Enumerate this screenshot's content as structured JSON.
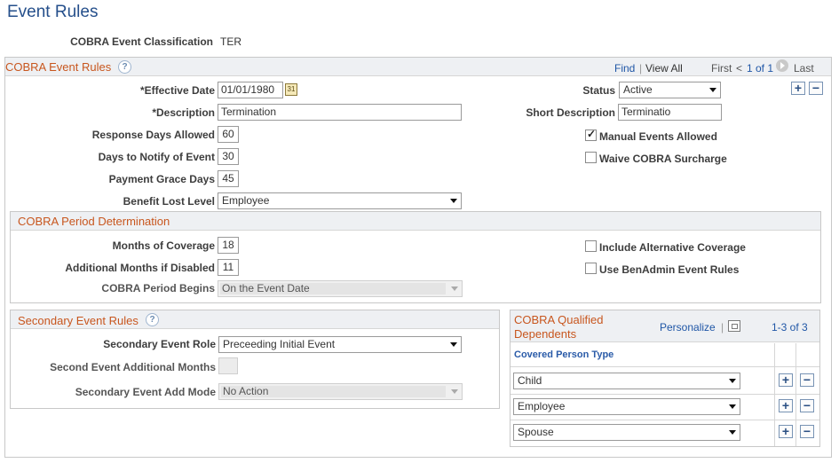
{
  "page": {
    "title": "Event Rules"
  },
  "header": {
    "classification_label": "COBRA Event Classification",
    "classification_value": "TER"
  },
  "event_rules": {
    "title": "COBRA Event Rules",
    "nav": {
      "find": "Find",
      "sep": "|",
      "view_all": "View All",
      "first": "First",
      "prev": "<",
      "page_of": "1 of 1",
      "last": "Last"
    },
    "effective_date": {
      "label": "*Effective Date",
      "value": "01/01/1980"
    },
    "status": {
      "label": "Status",
      "value": "Active"
    },
    "description": {
      "label": "*Description",
      "value": "Termination"
    },
    "short_description": {
      "label": "Short Description",
      "value": "Terminatio"
    },
    "response_days": {
      "label": "Response Days Allowed",
      "value": "60"
    },
    "days_to_notify": {
      "label": "Days to Notify of Event",
      "value": "30"
    },
    "payment_grace": {
      "label": "Payment Grace Days",
      "value": "45"
    },
    "benefit_lost_level": {
      "label": "Benefit Lost Level",
      "value": "Employee"
    },
    "manual_events": {
      "label": "Manual Events Allowed",
      "checked": true
    },
    "waive_surcharge": {
      "label": "Waive COBRA Surcharge",
      "checked": false
    }
  },
  "period": {
    "title": "COBRA Period Determination",
    "months_coverage": {
      "label": "Months of Coverage",
      "value": "18"
    },
    "additional_months": {
      "label": "Additional Months if Disabled",
      "value": "11"
    },
    "period_begins": {
      "label": "COBRA Period Begins",
      "value": "On the Event Date"
    },
    "include_alt": {
      "label": "Include Alternative Coverage",
      "checked": false
    },
    "use_benadmin": {
      "label": "Use BenAdmin Event Rules",
      "checked": false
    }
  },
  "secondary": {
    "title": "Secondary Event Rules",
    "role": {
      "label": "Secondary Event Role",
      "value": "Preceeding Initial Event"
    },
    "additional_months": {
      "label": "Second Event Additional Months",
      "value": ""
    },
    "add_mode": {
      "label": "Secondary Event Add Mode",
      "value": "No Action"
    }
  },
  "dependents": {
    "title_line1": "COBRA Qualified",
    "title_line2": "Dependents",
    "personalize": "Personalize",
    "sep": "|",
    "count": "1-3 of 3",
    "column_header": "Covered Person Type",
    "rows": [
      "Child",
      "Employee",
      "Spouse"
    ],
    "add": "+",
    "remove": "−"
  }
}
